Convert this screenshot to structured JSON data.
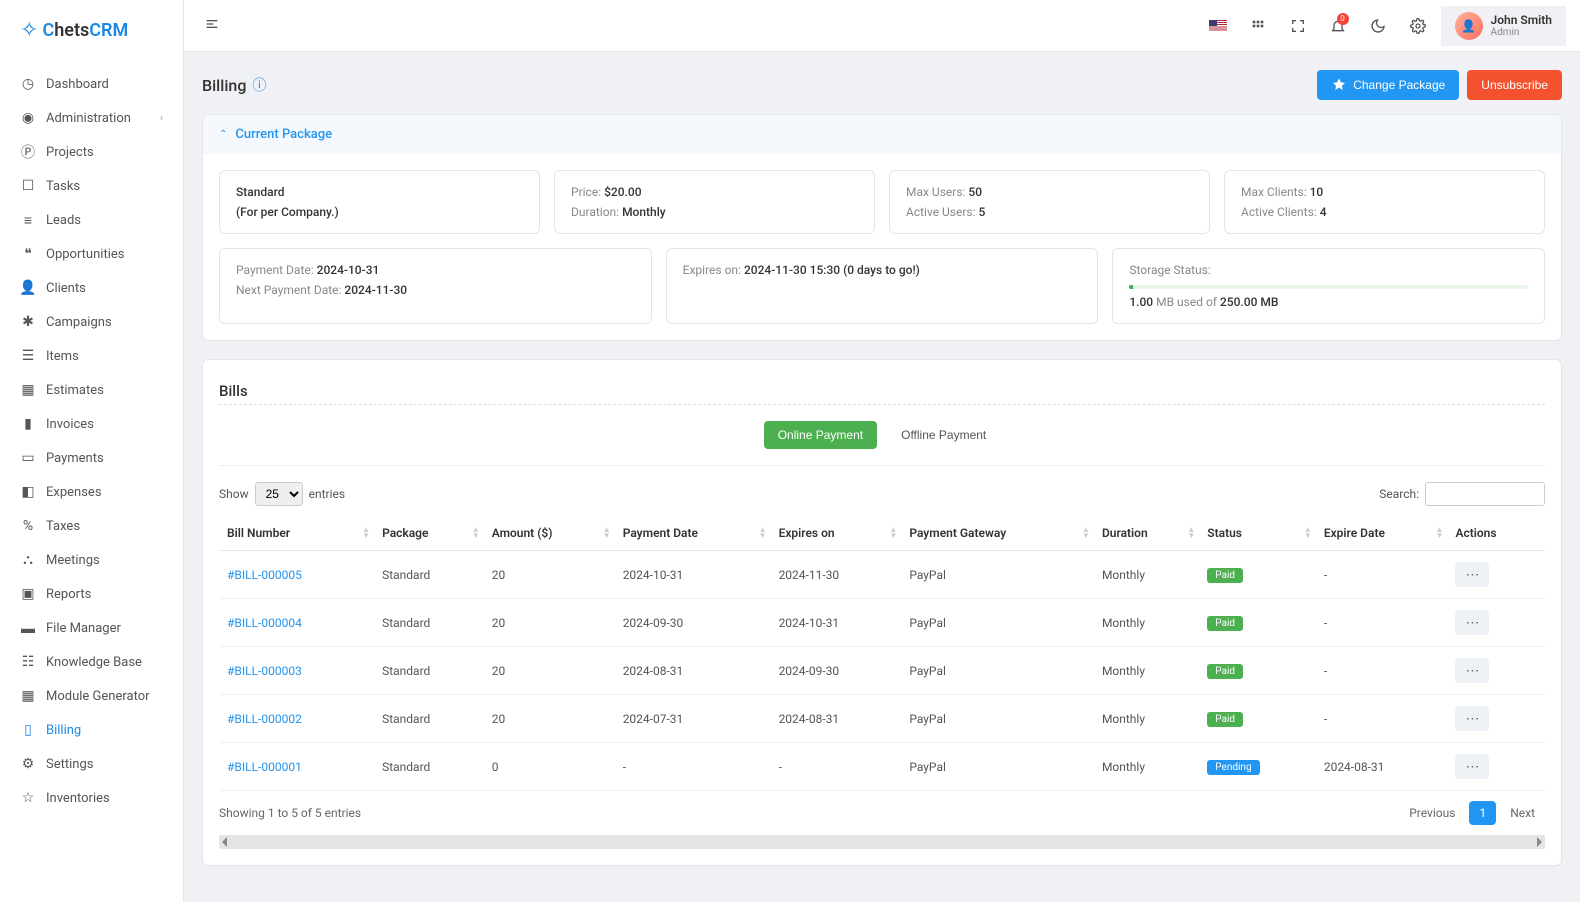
{
  "brand": "ChetsCRM",
  "user": {
    "name": "John Smith",
    "role": "Admin"
  },
  "notifications_count": "0",
  "sidebar": {
    "items": [
      {
        "label": "Dashboard",
        "icon": "dashboard"
      },
      {
        "label": "Administration",
        "icon": "user-circle",
        "expandable": true
      },
      {
        "label": "Projects",
        "icon": "project"
      },
      {
        "label": "Tasks",
        "icon": "task"
      },
      {
        "label": "Leads",
        "icon": "leads"
      },
      {
        "label": "Opportunities",
        "icon": "opportunity"
      },
      {
        "label": "Clients",
        "icon": "clients"
      },
      {
        "label": "Campaigns",
        "icon": "campaign"
      },
      {
        "label": "Items",
        "icon": "items"
      },
      {
        "label": "Estimates",
        "icon": "estimates"
      },
      {
        "label": "Invoices",
        "icon": "invoices"
      },
      {
        "label": "Payments",
        "icon": "payments"
      },
      {
        "label": "Expenses",
        "icon": "expenses"
      },
      {
        "label": "Taxes",
        "icon": "taxes"
      },
      {
        "label": "Meetings",
        "icon": "meetings"
      },
      {
        "label": "Reports",
        "icon": "reports"
      },
      {
        "label": "File Manager",
        "icon": "files"
      },
      {
        "label": "Knowledge Base",
        "icon": "kb"
      },
      {
        "label": "Module Generator",
        "icon": "module"
      },
      {
        "label": "Billing",
        "icon": "billing",
        "active": true
      },
      {
        "label": "Settings",
        "icon": "settings"
      },
      {
        "label": "Inventories",
        "icon": "inventories"
      }
    ]
  },
  "page": {
    "title": "Billing",
    "actions": {
      "change_package": "Change Package",
      "unsubscribe": "Unsubscribe"
    }
  },
  "package_panel": {
    "title": "Current Package",
    "plan_name": "Standard",
    "plan_note": "(For per Company.)",
    "price_label": "Price:",
    "price": "$20.00",
    "duration_label": "Duration:",
    "duration": "Monthly",
    "max_users_label": "Max Users:",
    "max_users": "50",
    "active_users_label": "Active Users:",
    "active_users": "5",
    "max_clients_label": "Max Clients:",
    "max_clients": "10",
    "active_clients_label": "Active Clients:",
    "active_clients": "4",
    "payment_date_label": "Payment Date:",
    "payment_date": "2024-10-31",
    "next_payment_label": "Next Payment Date:",
    "next_payment": "2024-11-30",
    "expires_label": "Expires on:",
    "expires": "2024-11-30 15:30 (0 days to go!)",
    "storage_status_label": "Storage Status:",
    "storage_used": "1.00",
    "storage_used_unit": "MB used of",
    "storage_total": "250.00 MB"
  },
  "bills": {
    "title": "Bills",
    "tabs": {
      "online": "Online Payment",
      "offline": "Offline Payment"
    },
    "show_label": "Show",
    "entries_label": "entries",
    "page_size": "25",
    "search_label": "Search:",
    "columns": [
      "Bill Number",
      "Package",
      "Amount ($)",
      "Payment Date",
      "Expires on",
      "Payment Gateway",
      "Duration",
      "Status",
      "Expire Date",
      "Actions"
    ],
    "rows": [
      {
        "bill": "#BILL-000005",
        "package": "Standard",
        "amount": "20",
        "payment_date": "2024-10-31",
        "expires": "2024-11-30",
        "gateway": "PayPal",
        "duration": "Monthly",
        "status": "Paid",
        "status_class": "success",
        "expire_date": "-"
      },
      {
        "bill": "#BILL-000004",
        "package": "Standard",
        "amount": "20",
        "payment_date": "2024-09-30",
        "expires": "2024-10-31",
        "gateway": "PayPal",
        "duration": "Monthly",
        "status": "Paid",
        "status_class": "success",
        "expire_date": "-"
      },
      {
        "bill": "#BILL-000003",
        "package": "Standard",
        "amount": "20",
        "payment_date": "2024-08-31",
        "expires": "2024-09-30",
        "gateway": "PayPal",
        "duration": "Monthly",
        "status": "Paid",
        "status_class": "success",
        "expire_date": "-"
      },
      {
        "bill": "#BILL-000002",
        "package": "Standard",
        "amount": "20",
        "payment_date": "2024-07-31",
        "expires": "2024-08-31",
        "gateway": "PayPal",
        "duration": "Monthly",
        "status": "Paid",
        "status_class": "success",
        "expire_date": "-"
      },
      {
        "bill": "#BILL-000001",
        "package": "Standard",
        "amount": "0",
        "payment_date": "-",
        "expires": "-",
        "gateway": "PayPal",
        "duration": "Monthly",
        "status": "Pending",
        "status_class": "info",
        "expire_date": "2024-08-31"
      }
    ],
    "footer_info": "Showing 1 to 5 of 5 entries",
    "prev": "Previous",
    "next": "Next",
    "page": "1"
  }
}
